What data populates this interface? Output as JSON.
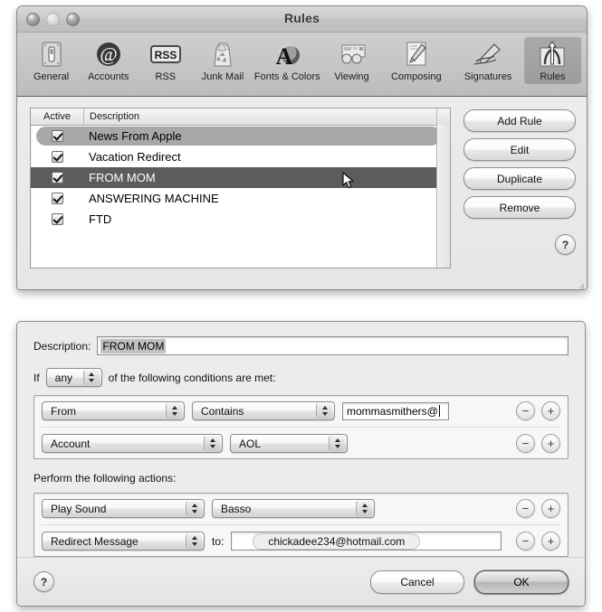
{
  "prefs_window": {
    "title": "Rules",
    "traffic_lights": [
      "close",
      "minimize",
      "zoom"
    ],
    "toolbar": [
      {
        "label": "General",
        "icon": "switch-plate-icon",
        "selected": false
      },
      {
        "label": "Accounts",
        "icon": "at-sign-icon",
        "selected": false
      },
      {
        "label": "RSS",
        "icon": "rss-badge-icon",
        "selected": false
      },
      {
        "label": "Junk Mail",
        "icon": "trash-bag-icon",
        "selected": false
      },
      {
        "label": "Fonts & Colors",
        "icon": "letter-a-icon",
        "selected": false
      },
      {
        "label": "Viewing",
        "icon": "eyeglasses-icon",
        "selected": false
      },
      {
        "label": "Composing",
        "icon": "pencil-paper-icon",
        "selected": false
      },
      {
        "label": "Signatures",
        "icon": "fountain-pen-icon",
        "selected": false
      },
      {
        "label": "Rules",
        "icon": "arrows-funnel-icon",
        "selected": true
      }
    ],
    "list": {
      "columns": [
        "Active",
        "Description"
      ],
      "rows": [
        {
          "active": true,
          "description": "News From Apple",
          "selection": "inactive"
        },
        {
          "active": true,
          "description": "Vacation Redirect",
          "selection": "none"
        },
        {
          "active": true,
          "description": "FROM MOM",
          "selection": "active"
        },
        {
          "active": true,
          "description": "ANSWERING MACHINE",
          "selection": "none"
        },
        {
          "active": true,
          "description": "FTD",
          "selection": "none"
        }
      ]
    },
    "buttons": [
      {
        "label": "Add Rule"
      },
      {
        "label": "Edit"
      },
      {
        "label": "Duplicate"
      },
      {
        "label": "Remove"
      }
    ],
    "help_label": "?"
  },
  "sheet": {
    "description_label": "Description:",
    "description_value": "FROM MOM",
    "if_label": "If",
    "match_mode": "any",
    "if_suffix": "of the following conditions are met:",
    "conditions": [
      {
        "field": "From",
        "operator": "Contains",
        "value": "mommasmithers@",
        "value_kind": "text"
      },
      {
        "field": "Account",
        "operator": "AOL",
        "value": "",
        "value_kind": "none"
      }
    ],
    "actions_label": "Perform the following actions:",
    "actions": [
      {
        "action": "Play Sound",
        "argument": "Basso",
        "arg_kind": "popup",
        "to_label": ""
      },
      {
        "action": "Redirect Message",
        "argument": "chickadee234@hotmail.com",
        "arg_kind": "token",
        "to_label": "to:"
      }
    ],
    "remove_label": "−",
    "add_label": "+",
    "help_label": "?",
    "cancel_label": "Cancel",
    "ok_label": "OK"
  },
  "colors": {
    "selection_active": "#5c5c5c",
    "selection_inactive": "#a8a8a8",
    "window_bg": "#ececec",
    "titlebar": "#c6c6c6"
  }
}
